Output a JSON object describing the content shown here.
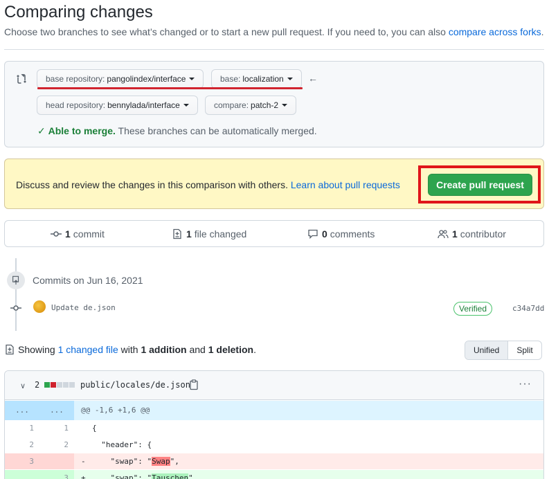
{
  "header": {
    "title": "Comparing changes",
    "subtitle": "Choose two branches to see what’s changed or to start a new pull request. If you need to, you can also",
    "subtitle_link": "compare across forks",
    "subtitle_end": "."
  },
  "range": {
    "base_repo_label": "base repository:",
    "base_repo_value": "pangolindex/interface",
    "base_label": "base:",
    "base_value": "localization",
    "head_repo_label": "head repository:",
    "head_repo_value": "bennylada/interface",
    "compare_label": "compare:",
    "compare_value": "patch-2",
    "merge_ok": "Able to merge.",
    "merge_note": "These branches can be automatically merged."
  },
  "cta": {
    "text": "Discuss and review the changes in this comparison with others.",
    "link": "Learn about pull requests",
    "button": "Create pull request"
  },
  "summary": {
    "commits_count": "1",
    "commits_label": "commit",
    "files_count": "1",
    "files_label": "file changed",
    "comments_count": "0",
    "comments_label": "comments",
    "contributors_count": "1",
    "contributors_label": "contributor"
  },
  "commits": {
    "date_heading": "Commits on Jun 16, 2021",
    "message": "Update de.json",
    "verified": "Verified",
    "sha": "c34a7dd"
  },
  "showing": {
    "prefix": "Showing",
    "changed_link": "1 changed file",
    "with": "with",
    "additions": "1 addition",
    "and": "and",
    "deletions": "1 deletion",
    "end": "."
  },
  "view_toggle": {
    "unified": "Unified",
    "split": "Split",
    "selected": "Unified"
  },
  "file": {
    "change_count": "2",
    "path": "public/locales/de.json",
    "diffstat_colors": [
      "#2da44e",
      "#cf222e",
      "#d0d7de",
      "#d0d7de",
      "#d0d7de"
    ],
    "hunk": {
      "left": "...",
      "right": "...",
      "header": "@@ -1,6 +1,6 @@"
    },
    "lines": [
      {
        "type": "ctx",
        "old": "1",
        "new": "1",
        "sign": " ",
        "pre": "{",
        "hl": "",
        "post": ""
      },
      {
        "type": "ctx",
        "old": "2",
        "new": "2",
        "sign": " ",
        "pre": "  \"header\": {",
        "hl": "",
        "post": ""
      },
      {
        "type": "del",
        "old": "3",
        "new": "",
        "sign": "-",
        "pre": "    \"swap\": \"",
        "hl": "Swap",
        "post": "\","
      },
      {
        "type": "add",
        "old": "",
        "new": "3",
        "sign": "+",
        "pre": "    \"swap\": \"",
        "hl": "Tauschen",
        "post": "\","
      }
    ]
  },
  "colors": {
    "accent_link": "#0969da",
    "primary_button": "#2da44e",
    "highlight_annotation": "#e0151a",
    "success": "#1a7f37"
  }
}
